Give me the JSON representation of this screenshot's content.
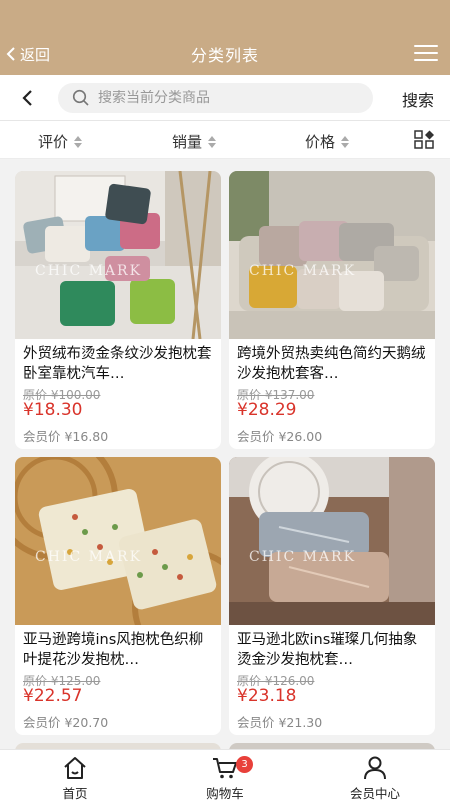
{
  "header": {
    "back_label": "返回",
    "title": "分类列表"
  },
  "search": {
    "placeholder": "搜索当前分类商品",
    "value": "",
    "button_label": "搜索"
  },
  "sort": {
    "items": [
      {
        "label": "评价"
      },
      {
        "label": "销量"
      },
      {
        "label": "价格"
      }
    ]
  },
  "products": [
    {
      "name": "外贸绒布烫金条纹沙发抱枕套卧室靠枕汽车…",
      "original_price": "原价 ¥100.00",
      "price": "¥18.30",
      "member_price": "会员价 ¥16.80",
      "watermark": "CHIC MARK"
    },
    {
      "name": "跨境外贸热卖纯色简约天鹅绒沙发抱枕套客…",
      "original_price": "原价 ¥137.00",
      "price": "¥28.29",
      "member_price": "会员价 ¥26.00",
      "watermark": "CHIC MARK"
    },
    {
      "name": "亚马逊跨境ins风抱枕色织柳叶提花沙发抱枕…",
      "original_price": "原价 ¥125.00",
      "price": "¥22.57",
      "member_price": "会员价 ¥20.70",
      "watermark": "CHIC MARK"
    },
    {
      "name": "亚马逊北欧ins璀璨几何抽象烫金沙发抱枕套…",
      "original_price": "原价 ¥126.00",
      "price": "¥23.18",
      "member_price": "会员价 ¥21.30",
      "watermark": "CHIC MARK"
    }
  ],
  "tabbar": {
    "items": [
      {
        "label": "首页",
        "icon": "home-icon"
      },
      {
        "label": "购物车",
        "icon": "cart-icon",
        "badge": "3"
      },
      {
        "label": "会员中心",
        "icon": "user-icon"
      }
    ]
  },
  "colors": {
    "header": "#c9ab86",
    "price": "#d9342b",
    "badge": "#e8403a"
  }
}
